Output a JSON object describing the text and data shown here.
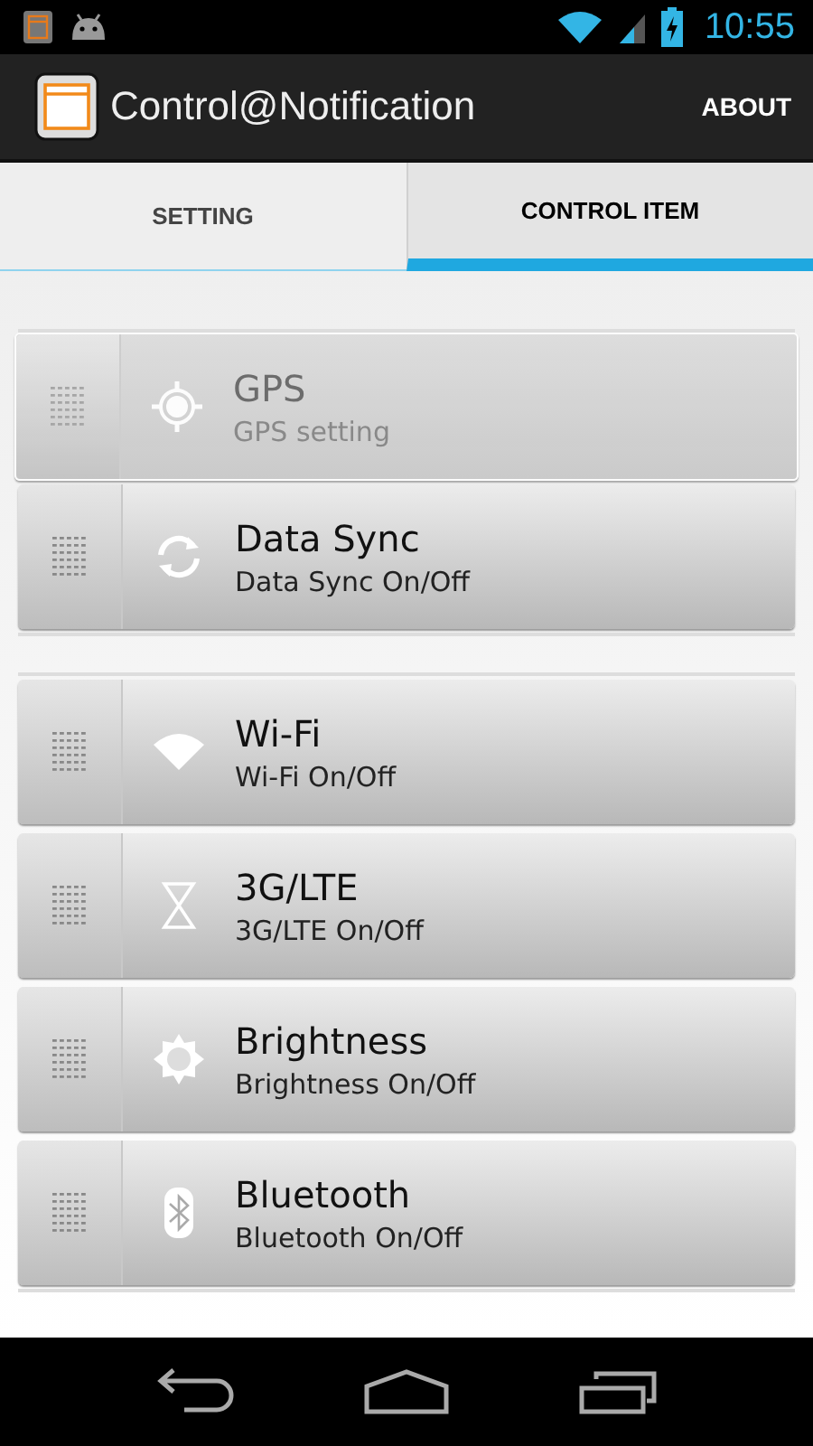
{
  "status_bar": {
    "time": "10:55"
  },
  "app_bar": {
    "title": "Control@Notification",
    "action": "ABOUT"
  },
  "tabs": [
    {
      "label": "SETTING",
      "selected": false
    },
    {
      "label": "CONTROL ITEM",
      "selected": true
    }
  ],
  "dragged_item": {
    "title": "GPS",
    "subtitle": "GPS setting",
    "kind": "gps"
  },
  "groups": [
    {
      "items": [
        {
          "title": "Data Sync",
          "subtitle": "Data Sync On/Off",
          "kind": "sync"
        }
      ]
    },
    {
      "items": [
        {
          "title": "Wi-Fi",
          "subtitle": "Wi-Fi On/Off",
          "kind": "wifi"
        },
        {
          "title": "3G/LTE",
          "subtitle": "3G/LTE On/Off",
          "kind": "mobile"
        },
        {
          "title": "Brightness",
          "subtitle": "Brightness On/Off",
          "kind": "brightness"
        },
        {
          "title": "Bluetooth",
          "subtitle": "Bluetooth On/Off",
          "kind": "bluetooth"
        }
      ]
    }
  ]
}
